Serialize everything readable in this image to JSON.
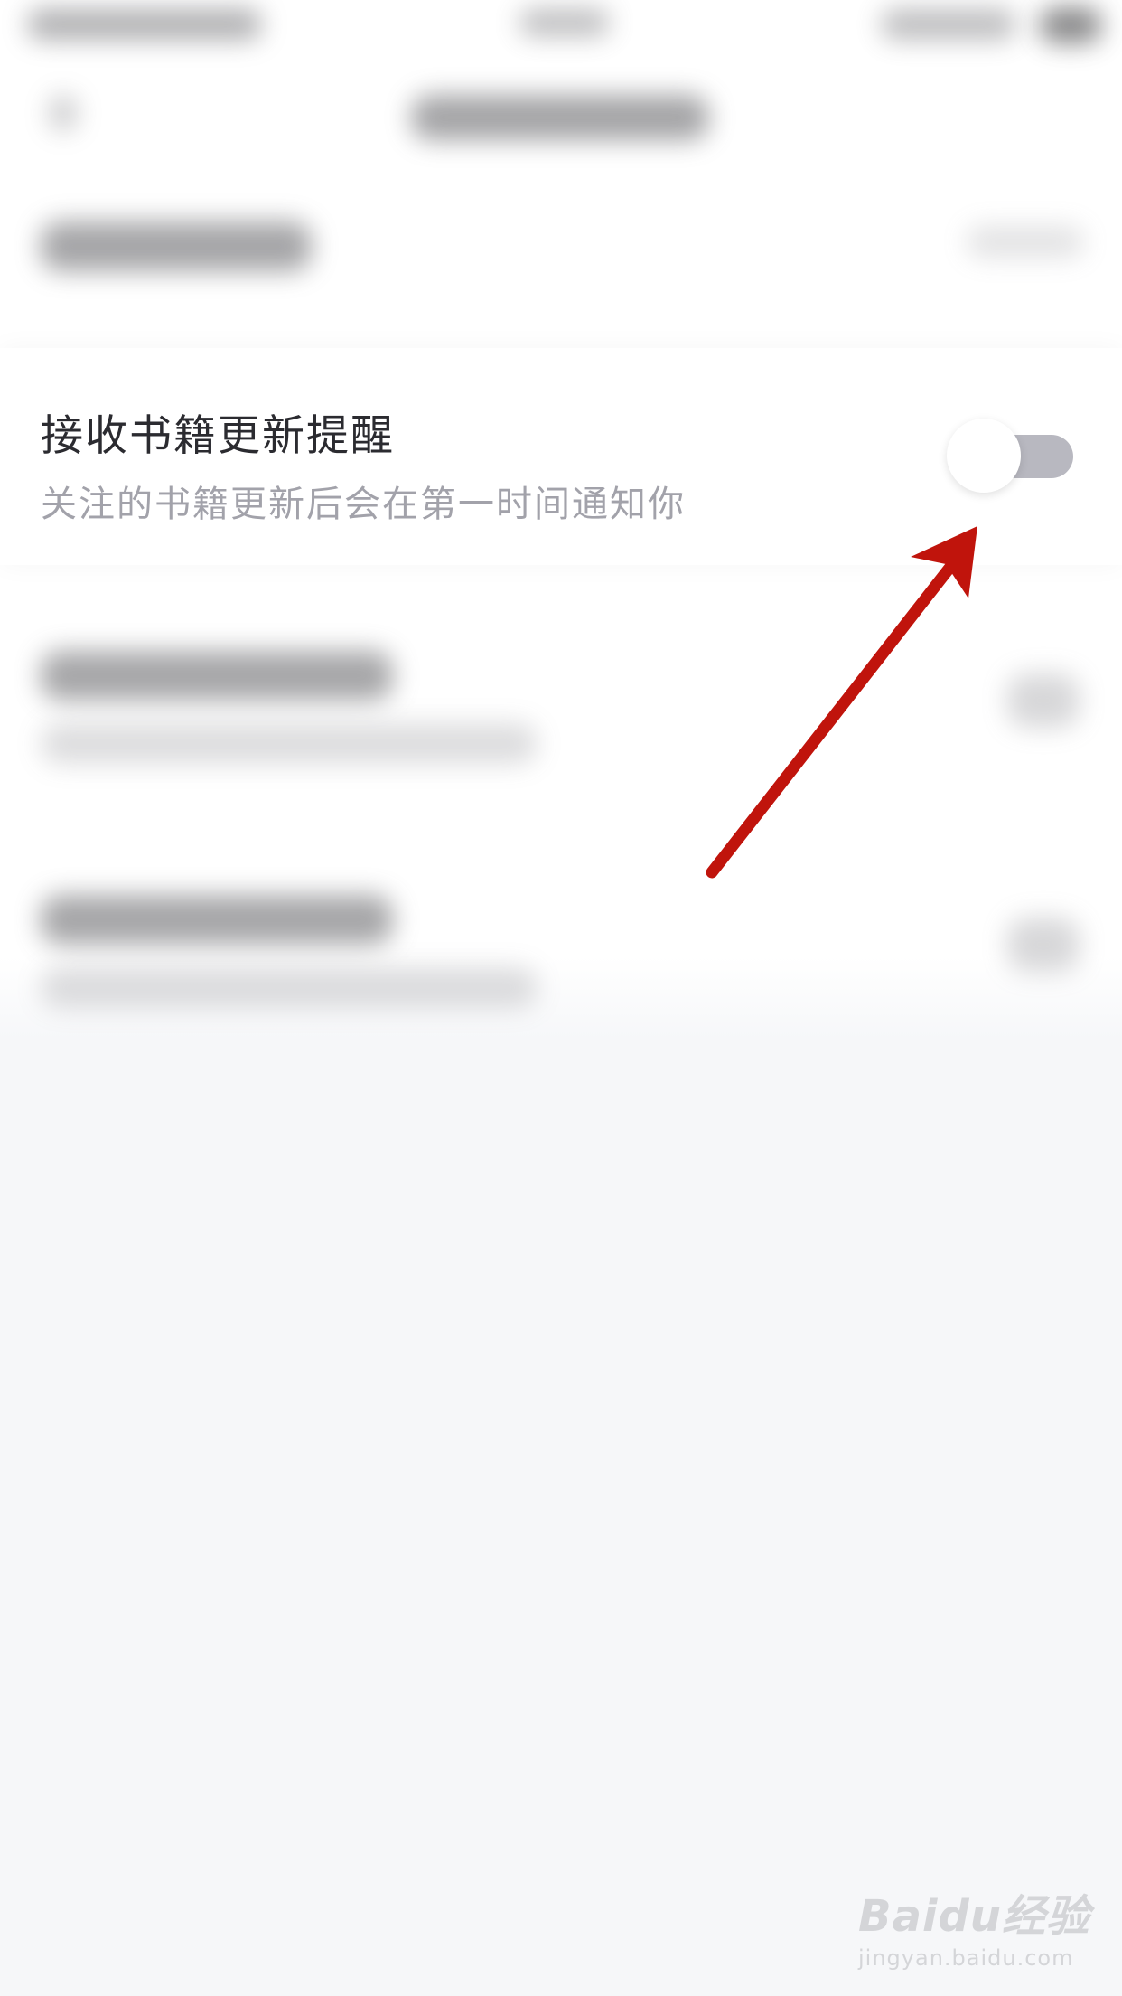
{
  "setting": {
    "title": "接收书籍更新提醒",
    "description": "关注的书籍更新后会在第一时间通知你",
    "toggle_on": false
  },
  "colors": {
    "title_text": "#2b2b30",
    "description_text": "#a2a2aa",
    "toggle_track_off": "#b8b8c0",
    "arrow": "#c0140c",
    "page_background": "#f6f7f9"
  },
  "icons": {
    "annotation_arrow": "arrow-icon",
    "watermark_paw": "paw-icon"
  },
  "watermark": {
    "logo": "Baidu经验",
    "url": "jingyan.baidu.com"
  }
}
